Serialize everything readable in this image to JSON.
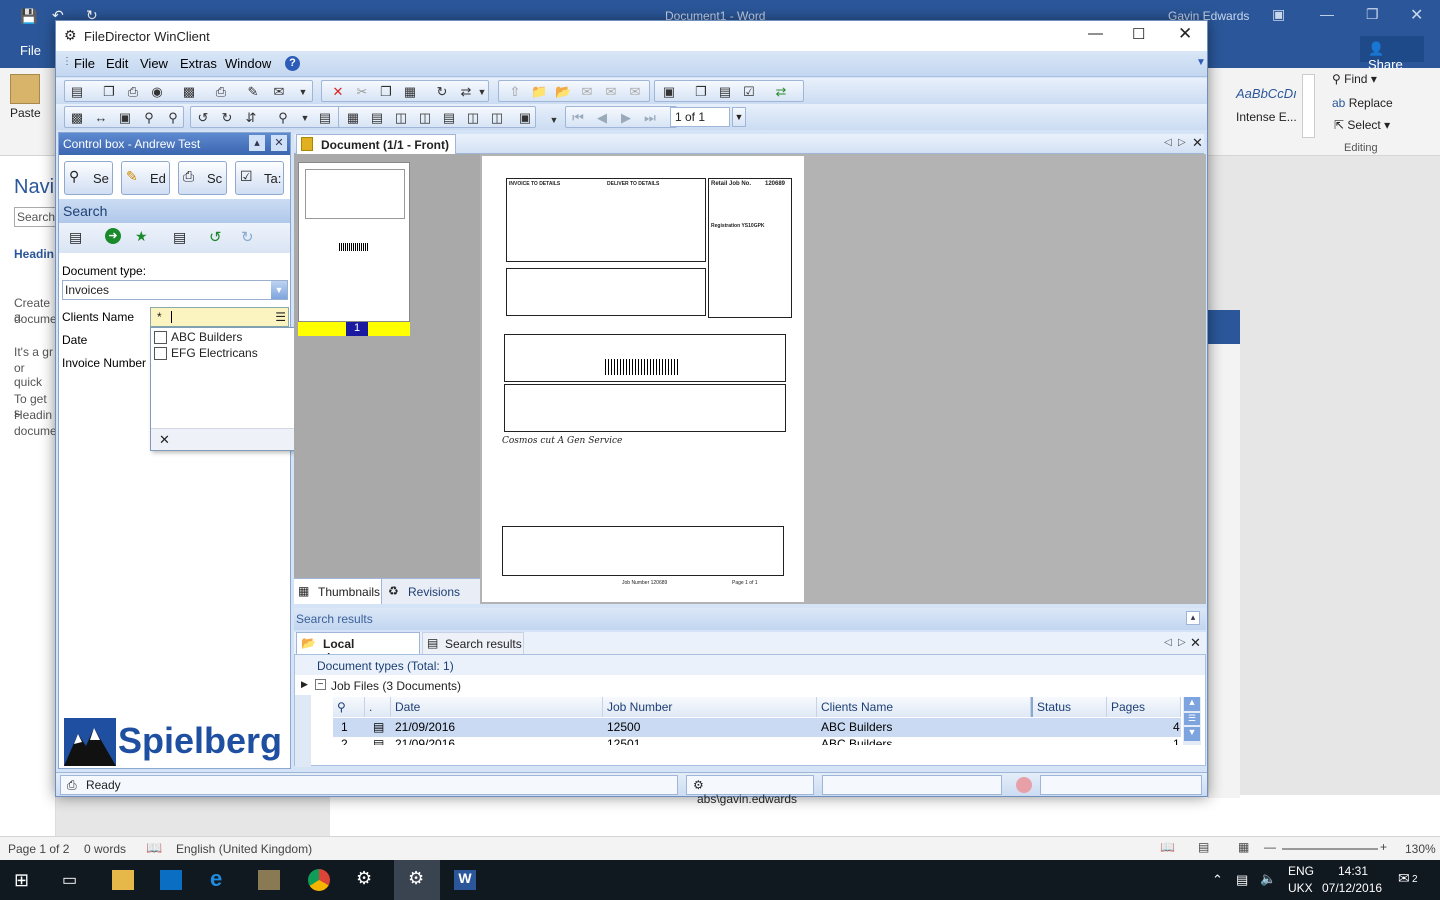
{
  "word": {
    "title": "Document1  -  Word",
    "user": "Gavin Edwards",
    "file_tab": "File",
    "share": "Share",
    "paste": "Paste",
    "find": "Find",
    "replace": "Replace",
    "select": "Select",
    "editing": "Editing",
    "style_sample": "AaBbCcDı",
    "style_name": "Intense E...",
    "nav_title": "Navi",
    "nav_search": "Search",
    "nav_heading": "Headin",
    "nav_text1": "Create a",
    "nav_text2": "docume",
    "nav_text3": "It's a gr",
    "nav_text4": "or quick",
    "nav_text5": "To get s",
    "nav_text6": "Headin",
    "nav_text7": "docume",
    "status_page": "Page 1 of 2",
    "status_words": "0 words",
    "status_lang": "English (United Kingdom)",
    "zoom": "130%"
  },
  "taskbar": {
    "lang1": "ENG",
    "lang2": "UKX",
    "time": "14:31",
    "date": "07/12/2016",
    "notif": "2"
  },
  "fd": {
    "title": "FileDirector WinClient",
    "menu": [
      "File",
      "Edit",
      "View",
      "Extras",
      "Window"
    ],
    "page_of": "1 of 1",
    "control_box_title": "Control box - Andrew Test",
    "big_buttons": [
      "Se",
      "Ed",
      "Sc",
      "Ta:"
    ],
    "search_label": "Search",
    "doctype_label": "Document type:",
    "doctype_value": "Invoices",
    "fields": [
      "Clients Name",
      "Date",
      "Invoice Number"
    ],
    "client_value": "*",
    "dropdown_items": [
      "ABC Builders",
      "EFG Electricans"
    ],
    "logo": "Spielberg",
    "doc_tab": "Document (1/1 - Front)",
    "thumb_tab": "Thumbnails",
    "rev_tab": "Revisions",
    "thumb_page": "1",
    "search_results_head": "Search results",
    "sr_tab_local": "Local documents",
    "sr_tab_search": "Search results",
    "doc_types_total": "Document types (Total: 1)",
    "job_files": "Job Files (3 Documents)",
    "columns": [
      "Date",
      "Job Number",
      "Clients Name",
      "Status",
      "Pages"
    ],
    "rows": [
      {
        "num": "1",
        "date": "21/09/2016",
        "job": "12500",
        "client": "ABC Builders",
        "status": "",
        "pages": "4"
      },
      {
        "num": "2",
        "date": "21/09/2016",
        "job": "12501",
        "client": "ABC Builders",
        "status": "",
        "pages": "1"
      }
    ],
    "status_ready": "Ready",
    "status_user": "abs\\gavin.edwards"
  },
  "invoice": {
    "box1": "INVOICE TO DETAILS",
    "box2": "DELIVER TO DETAILS",
    "retail_job": "Retail Job No.",
    "job_no": "120689",
    "registration": "Registration YS10GPK",
    "handwriting": "Cosmos cut A Gen Service",
    "job_number_footer": "Job Number 120689",
    "page_footer": "Page 1 of 1"
  }
}
